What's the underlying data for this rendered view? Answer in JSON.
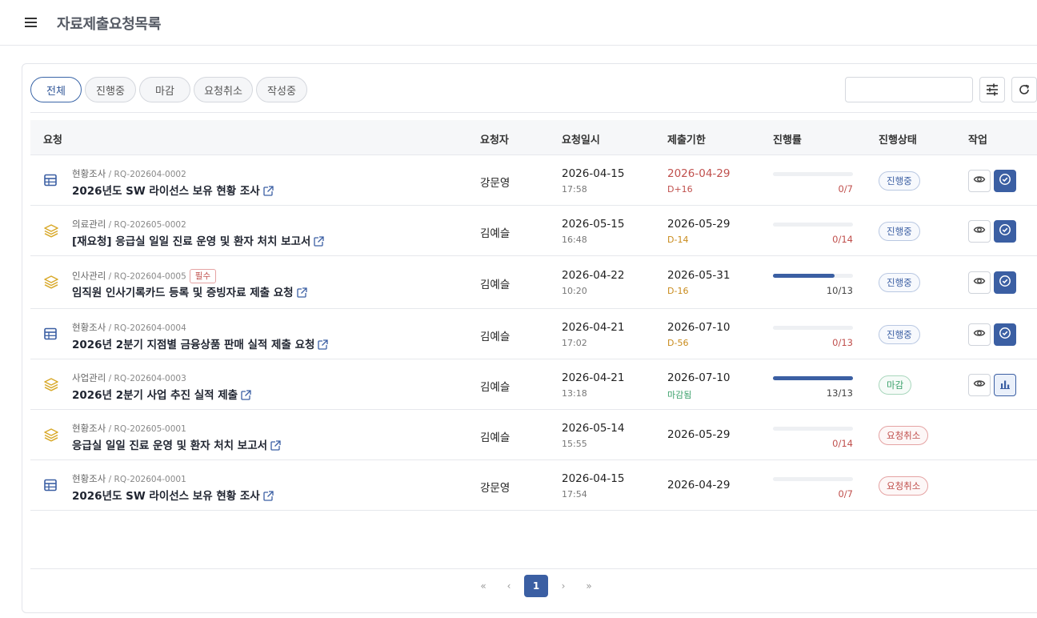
{
  "header": {
    "title": "자료제출요청목록"
  },
  "filters": [
    {
      "label": "전체",
      "active": true
    },
    {
      "label": "진행중",
      "active": false
    },
    {
      "label": "마감",
      "active": false
    },
    {
      "label": "요청취소",
      "active": false
    },
    {
      "label": "작성중",
      "active": false
    }
  ],
  "search": {
    "value": "",
    "placeholder": ""
  },
  "columns": {
    "request": "요청",
    "requester": "요청자",
    "requested_at": "요청일시",
    "deadline": "제출기한",
    "progress": "진행률",
    "status": "진행상태",
    "actions": "작업"
  },
  "rows": [
    {
      "icon": "table-icon",
      "category": "현황조사",
      "code": "RQ-202604-0002",
      "required": "",
      "title": "2026년도 SW 라이선스 보유 현황 조사",
      "requester": "강문영",
      "date": "2026-04-15",
      "time": "17:58",
      "due": "2026-04-29",
      "due_sub": "D+16",
      "due_tone": "red",
      "progress_text": "0/7",
      "progress": 0,
      "status": "진행중",
      "status_type": "ongoing",
      "actions": [
        "view",
        "submit"
      ]
    },
    {
      "icon": "layers-icon",
      "category": "의료관리",
      "code": "RQ-202605-0002",
      "required": "",
      "title": "[재요청] 응급실 일일 진료 운영 및 환자 처치 보고서",
      "requester": "김예슬",
      "date": "2026-05-15",
      "time": "16:48",
      "due": "2026-05-29",
      "due_sub": "D-14",
      "due_tone": "orange",
      "progress_text": "0/14",
      "progress": 0,
      "status": "진행중",
      "status_type": "ongoing",
      "actions": [
        "view",
        "submit"
      ]
    },
    {
      "icon": "layers-icon",
      "category": "인사관리",
      "code": "RQ-202604-0005",
      "required": "필수",
      "title": "임직원 인사기록카드 등록 및 증빙자료 제출 요청",
      "requester": "김예슬",
      "date": "2026-04-22",
      "time": "10:20",
      "due": "2026-05-31",
      "due_sub": "D-16",
      "due_tone": "orange",
      "progress_text": "10/13",
      "progress": 0.769,
      "status": "진행중",
      "status_type": "ongoing",
      "actions": [
        "view",
        "submit"
      ]
    },
    {
      "icon": "table-icon",
      "category": "현황조사",
      "code": "RQ-202604-0004",
      "required": "",
      "title": "2026년 2분기 지점별 금융상품 판매 실적 제출 요청",
      "requester": "김예슬",
      "date": "2026-04-21",
      "time": "17:02",
      "due": "2026-07-10",
      "due_sub": "D-56",
      "due_tone": "orange",
      "progress_text": "0/13",
      "progress": 0,
      "status": "진행중",
      "status_type": "ongoing",
      "actions": [
        "view",
        "submit"
      ]
    },
    {
      "icon": "layers-icon",
      "category": "사업관리",
      "code": "RQ-202604-0003",
      "required": "",
      "title": "2026년 2분기 사업 추진 실적 제출",
      "requester": "김예슬",
      "date": "2026-04-21",
      "time": "13:18",
      "due": "2026-07-10",
      "due_sub": "마감됨",
      "due_tone": "green",
      "progress_text": "13/13",
      "progress": 1,
      "status": "마감",
      "status_type": "closed",
      "actions": [
        "view",
        "stats"
      ]
    },
    {
      "icon": "layers-icon",
      "category": "현황조사",
      "code": "RQ-202605-0001",
      "required": "",
      "title": "응급실 일일 진료 운영 및 환자 처치 보고서",
      "requester": "김예슬",
      "date": "2026-05-14",
      "time": "15:55",
      "due": "2026-05-29",
      "due_sub": "",
      "due_tone": "",
      "progress_text": "0/14",
      "progress": 0,
      "status": "요청취소",
      "status_type": "cancel",
      "actions": []
    },
    {
      "icon": "table-icon",
      "category": "현황조사",
      "code": "RQ-202604-0001",
      "required": "",
      "title": "2026년도 SW 라이선스 보유 현황 조사",
      "requester": "강문영",
      "date": "2026-04-15",
      "time": "17:54",
      "due": "2026-04-29",
      "due_sub": "",
      "due_tone": "",
      "progress_text": "0/7",
      "progress": 0,
      "status": "요청취소",
      "status_type": "cancel",
      "actions": []
    }
  ],
  "pagination": {
    "first": "«",
    "prev": "‹",
    "current": "1",
    "next": "›",
    "last": "»"
  },
  "colors": {
    "accent": "#3b5fa3",
    "danger": "#c0504d",
    "warning": "#c98b1c",
    "success": "#3aa06a",
    "icon_gold": "#d8a92a"
  }
}
